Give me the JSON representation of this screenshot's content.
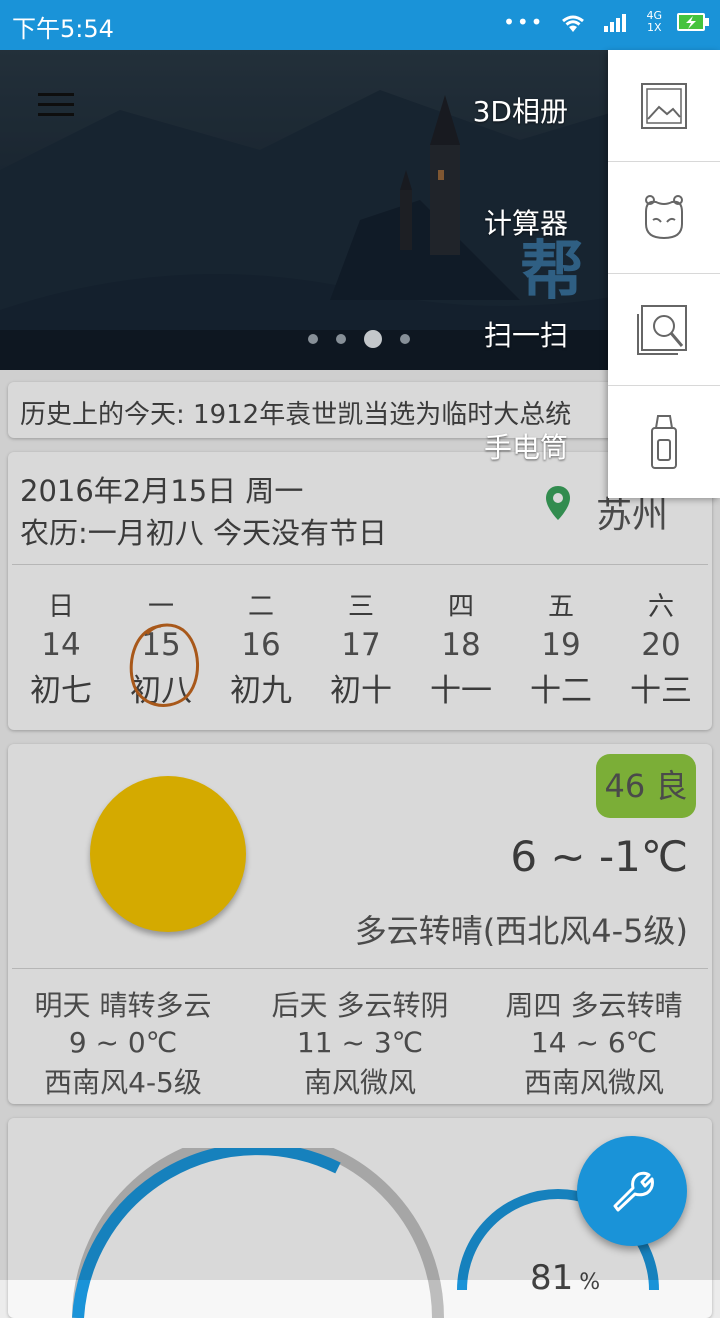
{
  "status_bar": {
    "time": "下午5:54",
    "network": "4G",
    "network_sub": "1X"
  },
  "hero": {
    "watermark": "帮",
    "slide_count": 4,
    "active_slide": 3
  },
  "menu": {
    "items": [
      "3D相册",
      "计算器",
      "扫一扫",
      "手电筒"
    ]
  },
  "history": {
    "text": "历史上的今天: 1912年袁世凯当选为临时大总统"
  },
  "date_card": {
    "date_line": "2016年2月15日 周一",
    "lunar_line": "农历:一月初八 今天没有节日",
    "city": "苏州",
    "week": [
      {
        "weekday": "日",
        "day": "14",
        "lunar": "初七"
      },
      {
        "weekday": "一",
        "day": "15",
        "lunar": "初八"
      },
      {
        "weekday": "二",
        "day": "16",
        "lunar": "初九"
      },
      {
        "weekday": "三",
        "day": "17",
        "lunar": "初十"
      },
      {
        "weekday": "四",
        "day": "18",
        "lunar": "十一"
      },
      {
        "weekday": "五",
        "day": "19",
        "lunar": "十二"
      },
      {
        "weekday": "六",
        "day": "20",
        "lunar": "十三"
      }
    ]
  },
  "weather": {
    "aqi": "46 良",
    "temp": "6 ~ -1℃",
    "desc": "多云转晴(西北风4-5级)",
    "forecast": [
      {
        "title": "明天 晴转多云",
        "temp": "9 ~ 0℃",
        "wind": "西南风4-5级"
      },
      {
        "title": "后天 多云转阴",
        "temp": "11 ~ 3℃",
        "wind": "南风微风"
      },
      {
        "title": "周四 多云转晴",
        "temp": "14 ~ 6℃",
        "wind": "西南风微风"
      }
    ]
  },
  "gauge": {
    "right_value": "81",
    "unit": "%"
  },
  "colors": {
    "accent": "#1a93d8",
    "sun": "#f2c200",
    "aqi_bg": "#8cc63f",
    "gauge": "#1a93d8"
  }
}
